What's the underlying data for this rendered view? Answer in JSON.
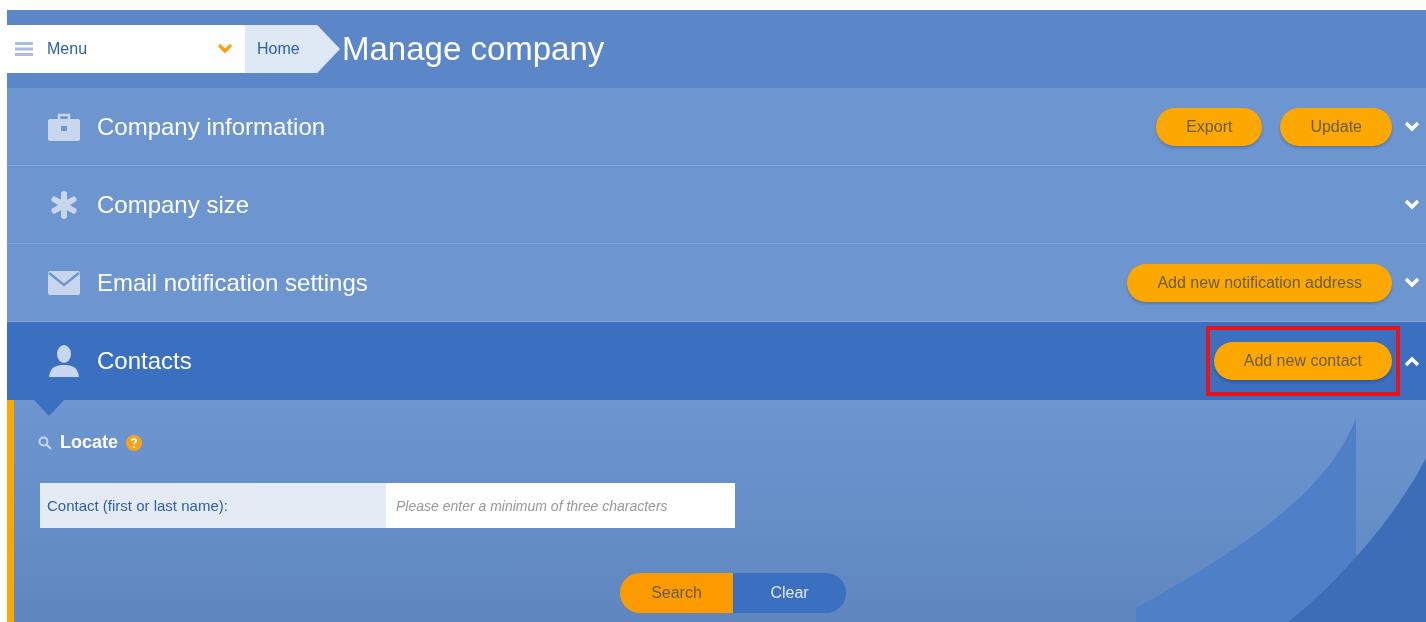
{
  "header": {
    "menu": {
      "label": "Menu"
    },
    "breadcrumb": "Home",
    "title": "Manage company"
  },
  "sections": [
    {
      "title": "Company information",
      "kind": "briefcase",
      "expanded": false,
      "actions": [
        {
          "label": "Export",
          "highlighted": false
        },
        {
          "label": "Update",
          "highlighted": false
        }
      ]
    },
    {
      "title": "Company size",
      "kind": "asterisk",
      "expanded": false
    },
    {
      "title": "Email notification settings",
      "kind": "envelope",
      "expanded": false,
      "actions": [
        {
          "label": "Add new notification address",
          "highlighted": false
        }
      ]
    },
    {
      "title": "Contacts",
      "kind": "person",
      "expanded": true,
      "actions": [
        {
          "label": "Add new contact",
          "highlighted": true
        }
      ]
    }
  ],
  "locate": {
    "title": "Locate",
    "field": {
      "label": "Contact (first or last name):",
      "placeholder": "Please enter a minimum of three characters"
    },
    "buttons": [
      {
        "label": "Search",
        "kind": "primary"
      },
      {
        "label": "Clear",
        "kind": "secondary"
      }
    ]
  }
}
